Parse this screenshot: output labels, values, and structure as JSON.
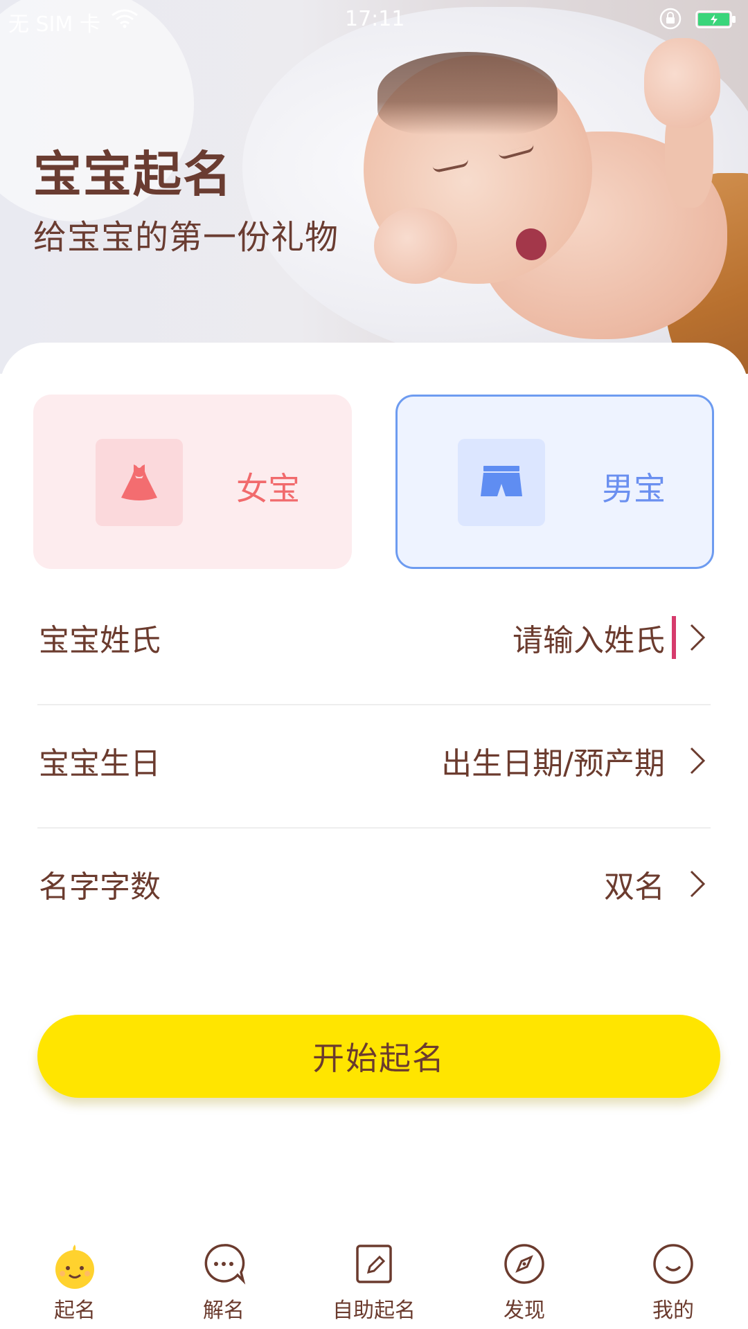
{
  "status_bar": {
    "carrier": "无 SIM 卡",
    "time": "17:11",
    "battery_color": "#3ad57a"
  },
  "hero": {
    "title": "宝宝起名",
    "subtitle": "给宝宝的第一份礼物"
  },
  "gender": {
    "girl_label": "女宝",
    "boy_label": "男宝",
    "selected": "男宝",
    "girl_color": "#f16a6c",
    "boy_color": "#6a8ff0"
  },
  "form": {
    "surname_label": "宝宝姓氏",
    "surname_placeholder": "请输入姓氏",
    "birthday_label": "宝宝生日",
    "birthday_value": "出生日期/预产期",
    "name_length_label": "名字字数",
    "name_length_value": "双名"
  },
  "start_button": {
    "label": "开始起名",
    "color": "#ffe500"
  },
  "tabbar": {
    "items": [
      {
        "label": "起名",
        "icon": "baby-face-icon",
        "active": true
      },
      {
        "label": "解名",
        "icon": "chat-bubble-icon",
        "active": false
      },
      {
        "label": "自助起名",
        "icon": "edit-icon",
        "active": false
      },
      {
        "label": "发现",
        "icon": "compass-icon",
        "active": false
      },
      {
        "label": "我的",
        "icon": "smile-icon",
        "active": false
      }
    ]
  }
}
